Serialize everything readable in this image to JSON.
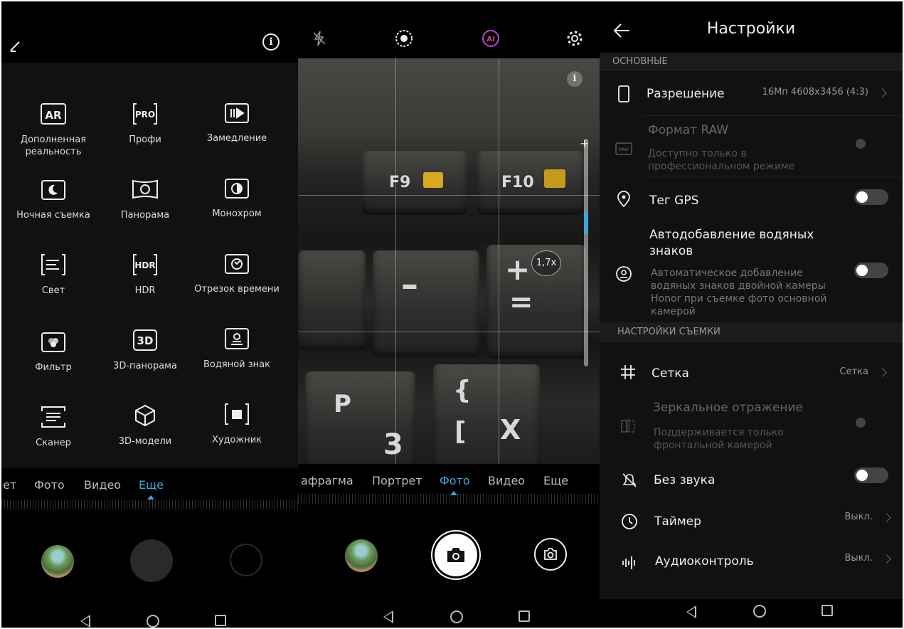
{
  "panel1": {
    "modes": [
      {
        "label": "Дополненная реальность",
        "icon": "ar-icon"
      },
      {
        "label": "Профи",
        "icon": "pro-icon"
      },
      {
        "label": "Замедление",
        "icon": "slow-motion-icon"
      },
      {
        "label": "Ночная съемка",
        "icon": "night-icon"
      },
      {
        "label": "Панорама",
        "icon": "panorama-icon"
      },
      {
        "label": "Монохром",
        "icon": "monochrome-icon"
      },
      {
        "label": "Свет",
        "icon": "light-painting-icon"
      },
      {
        "label": "HDR",
        "icon": "hdr-icon"
      },
      {
        "label": "Отрезок времени",
        "icon": "time-lapse-icon"
      },
      {
        "label": "Фильтр",
        "icon": "filter-icon"
      },
      {
        "label": "3D-панорама",
        "icon": "3d-panorama-icon"
      },
      {
        "label": "Водяной знак",
        "icon": "watermark-icon"
      },
      {
        "label": "Сканер",
        "icon": "scanner-icon"
      },
      {
        "label": "3D-модели",
        "icon": "3d-models-icon"
      },
      {
        "label": "Художник",
        "icon": "artist-icon"
      }
    ],
    "modebar": [
      "ет",
      "Фото",
      "Видео",
      "Еще"
    ],
    "active_mode": "Еще"
  },
  "panel2": {
    "modebar": [
      "афрагма",
      "Портрет",
      "Фото",
      "Видео",
      "Еще"
    ],
    "active_mode": "Фото",
    "zoom": "1,7x",
    "info_glyph": "i",
    "keys": [
      "F9",
      "F10",
      "–",
      "+",
      "=",
      "P",
      "{",
      "[",
      "X",
      "3"
    ],
    "ai_label": "AI"
  },
  "panel3": {
    "title": "Настройки",
    "sections": {
      "basic": "ОСНОВНЫЕ",
      "shooting": "НАСТРОЙКИ СЪЕМКИ"
    },
    "rows": {
      "resolution": {
        "title": "Разрешение",
        "value": "16Мп 4608x3456 (4:3)"
      },
      "raw": {
        "title": "Формат RAW",
        "sub": "Доступно только в профессиональном режиме",
        "icon_text": "RAW"
      },
      "gps": {
        "title": "Тег GPS",
        "toggle": false
      },
      "watermark": {
        "title": "Автодобавление водяных знаков",
        "sub": "Автоматическое добавление водяных знаков двойной камеры Honor при съемке фото основной камерой",
        "toggle": false
      },
      "grid": {
        "title": "Сетка",
        "value": "Сетка"
      },
      "mirror": {
        "title": "Зеркальное отражение",
        "sub": "Поддерживается только фронтальной камерой"
      },
      "mute": {
        "title": "Без звука",
        "toggle": false
      },
      "timer": {
        "title": "Таймер",
        "value": "Выкл."
      },
      "audio": {
        "title": "Аудиоконтроль",
        "value": "Выкл."
      }
    }
  },
  "colors": {
    "accent": "#3aa8d8",
    "background": "#000000",
    "settings_bg": "#111111"
  }
}
